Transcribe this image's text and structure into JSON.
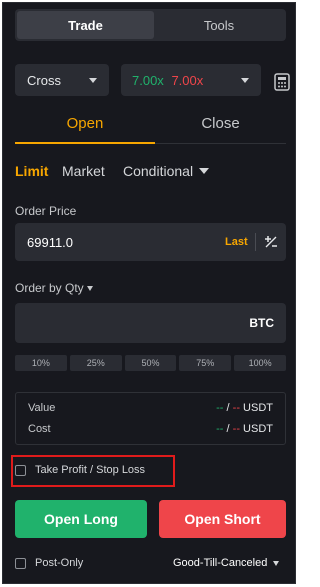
{
  "top_tabs": {
    "trade": "Trade",
    "tools": "Tools"
  },
  "margin_mode": {
    "value": "Cross"
  },
  "leverage": {
    "long": "7.00x",
    "short": "7.00x"
  },
  "position_tabs": {
    "open": "Open",
    "close": "Close"
  },
  "order_types": {
    "limit": "Limit",
    "market": "Market",
    "conditional": "Conditional"
  },
  "order_price": {
    "label": "Order Price",
    "value": "69911.0",
    "last": "Last"
  },
  "order_qty": {
    "label": "Order by Qty",
    "unit": "BTC",
    "value": ""
  },
  "percentages": [
    "10%",
    "25%",
    "50%",
    "75%",
    "100%"
  ],
  "summary": {
    "value_label": "Value",
    "cost_label": "Cost",
    "long_placeholder": "--",
    "separator": "/",
    "short_placeholder": "--",
    "currency": "USDT"
  },
  "tpsl": {
    "label": "Take Profit / Stop Loss",
    "checked": false
  },
  "buttons": {
    "open_long": "Open Long",
    "open_short": "Open Short"
  },
  "post_only": {
    "label": "Post-Only",
    "checked": false
  },
  "time_in_force": {
    "value": "Good-Till-Canceled"
  },
  "colors": {
    "accent": "#f7a600",
    "long": "#20b26c",
    "short": "#ef454a",
    "background": "#17181e",
    "highlight_frame": "#e01b1b"
  },
  "icons": {
    "calculator": "calculator-icon",
    "caret": "caret-down-icon",
    "price_adjust": "plus-minus-icon"
  }
}
